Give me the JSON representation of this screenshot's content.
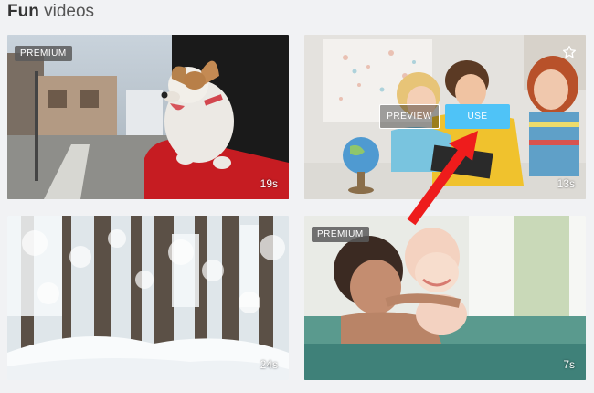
{
  "header": {
    "title_bold": "Fun",
    "title_rest": "videos"
  },
  "cards": [
    {
      "badge": "PREMIUM",
      "duration": "19s",
      "scene": "dog in car window"
    },
    {
      "duration": "13s",
      "preview_label": "PREVIEW",
      "use_label": "USE",
      "star_icon": "star-outline-icon",
      "scene": "children with tablet and globe"
    },
    {
      "duration": "24s",
      "scene": "snowy forest"
    },
    {
      "badge": "PREMIUM",
      "duration": "7s",
      "scene": "father and baby in pool"
    }
  ],
  "annotation": {
    "arrow_color": "#ee1c1c"
  },
  "colors": {
    "use_button": "#4fc3f7",
    "badge_bg": "#5a5a5a"
  }
}
